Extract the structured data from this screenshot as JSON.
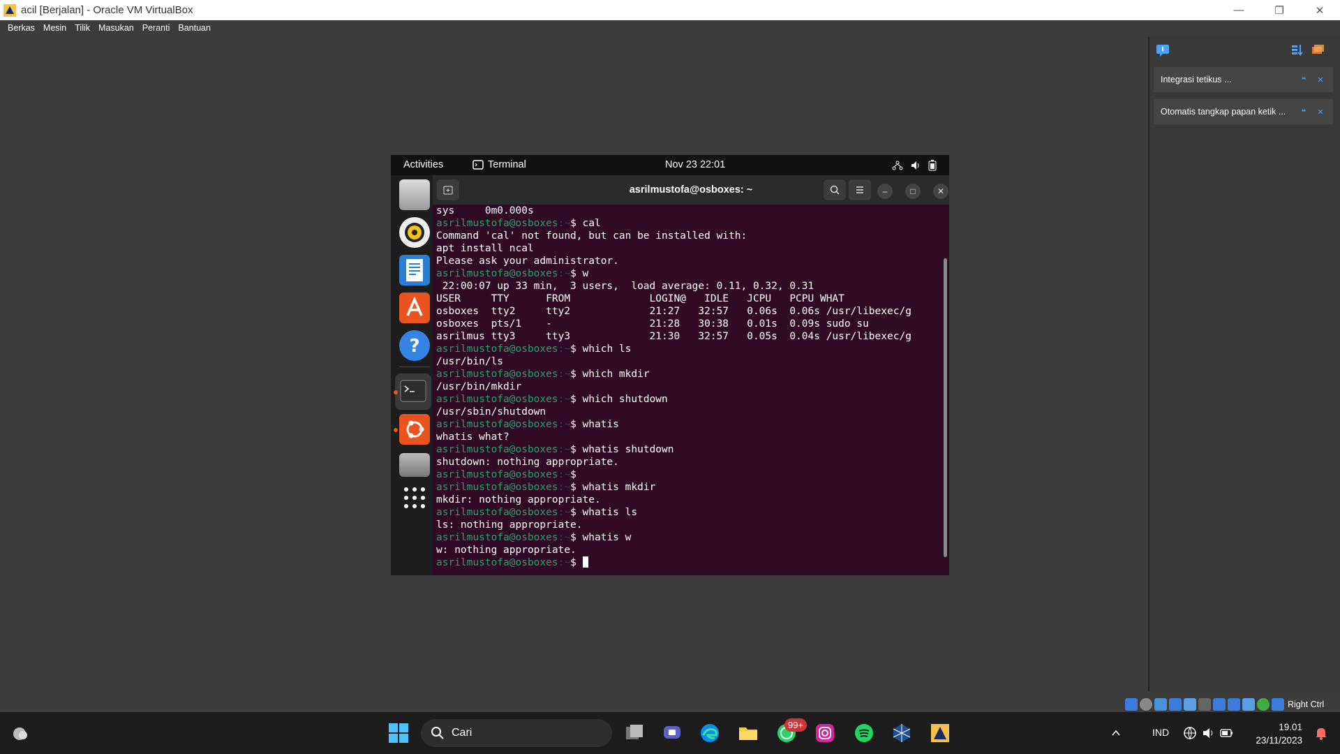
{
  "window": {
    "title": "acil [Berjalan] - Oracle VM VirtualBox",
    "controls": [
      "minimize",
      "restore",
      "close"
    ]
  },
  "menubar": [
    "Berkas",
    "Mesin",
    "Tilik",
    "Masukan",
    "Peranti",
    "Bantuan"
  ],
  "vb_panel": {
    "notifications": [
      {
        "text": "Integrasi tetikus ..."
      },
      {
        "text": "Otomatis tangkap papan ketik ..."
      }
    ]
  },
  "vb_status": {
    "host_key": "Right Ctrl"
  },
  "gnome": {
    "activities": "Activities",
    "app": "Terminal",
    "clock": "Nov 23  22:01"
  },
  "terminal": {
    "title": "asrilmustofa@osboxes: ~",
    "prompt_user": "asrilmustofa@osboxes",
    "prompt_path": ":~",
    "lines": [
      {
        "kind": "out",
        "text": "sys     0m0.000s"
      },
      {
        "kind": "cmd",
        "text": "$ cal"
      },
      {
        "kind": "out",
        "text": "Command 'cal' not found, but can be installed with:"
      },
      {
        "kind": "out",
        "text": "apt install ncal"
      },
      {
        "kind": "out",
        "text": "Please ask your administrator."
      },
      {
        "kind": "cmd",
        "text": "$ w"
      },
      {
        "kind": "out",
        "text": " 22:00:07 up 33 min,  3 users,  load average: 0.11, 0.32, 0.31"
      },
      {
        "kind": "out",
        "text": "USER     TTY      FROM             LOGIN@   IDLE   JCPU   PCPU WHAT"
      },
      {
        "kind": "out",
        "text": "osboxes  tty2     tty2             21:27   32:57   0.06s  0.06s /usr/libexec/g"
      },
      {
        "kind": "out",
        "text": "osboxes  pts/1    -                21:28   30:38   0.01s  0.09s sudo su"
      },
      {
        "kind": "out",
        "text": "asrilmus tty3     tty3             21:30   32:57   0.05s  0.04s /usr/libexec/g"
      },
      {
        "kind": "cmd",
        "text": "$ which ls"
      },
      {
        "kind": "out",
        "text": "/usr/bin/ls"
      },
      {
        "kind": "cmd",
        "text": "$ which mkdir"
      },
      {
        "kind": "out",
        "text": "/usr/bin/mkdir"
      },
      {
        "kind": "cmd",
        "text": "$ which shutdown"
      },
      {
        "kind": "out",
        "text": "/usr/sbin/shutdown"
      },
      {
        "kind": "cmd",
        "text": "$ whatis"
      },
      {
        "kind": "out",
        "text": "whatis what?"
      },
      {
        "kind": "cmd",
        "text": "$ whatis shutdown"
      },
      {
        "kind": "out",
        "text": "shutdown: nothing appropriate."
      },
      {
        "kind": "cmd",
        "text": "$"
      },
      {
        "kind": "cmd",
        "text": "$ whatis mkdir"
      },
      {
        "kind": "out",
        "text": "mkdir: nothing appropriate."
      },
      {
        "kind": "cmd",
        "text": "$ whatis ls"
      },
      {
        "kind": "out",
        "text": "ls: nothing appropriate."
      },
      {
        "kind": "cmd",
        "text": "$ whatis w"
      },
      {
        "kind": "out",
        "text": "w: nothing appropriate."
      },
      {
        "kind": "cmd",
        "text": "$ ",
        "cursor": true
      }
    ]
  },
  "taskbar": {
    "search_placeholder": "Cari",
    "badge": "99+",
    "lang": "IND",
    "time": "19.01",
    "date": "23/11/2023"
  }
}
